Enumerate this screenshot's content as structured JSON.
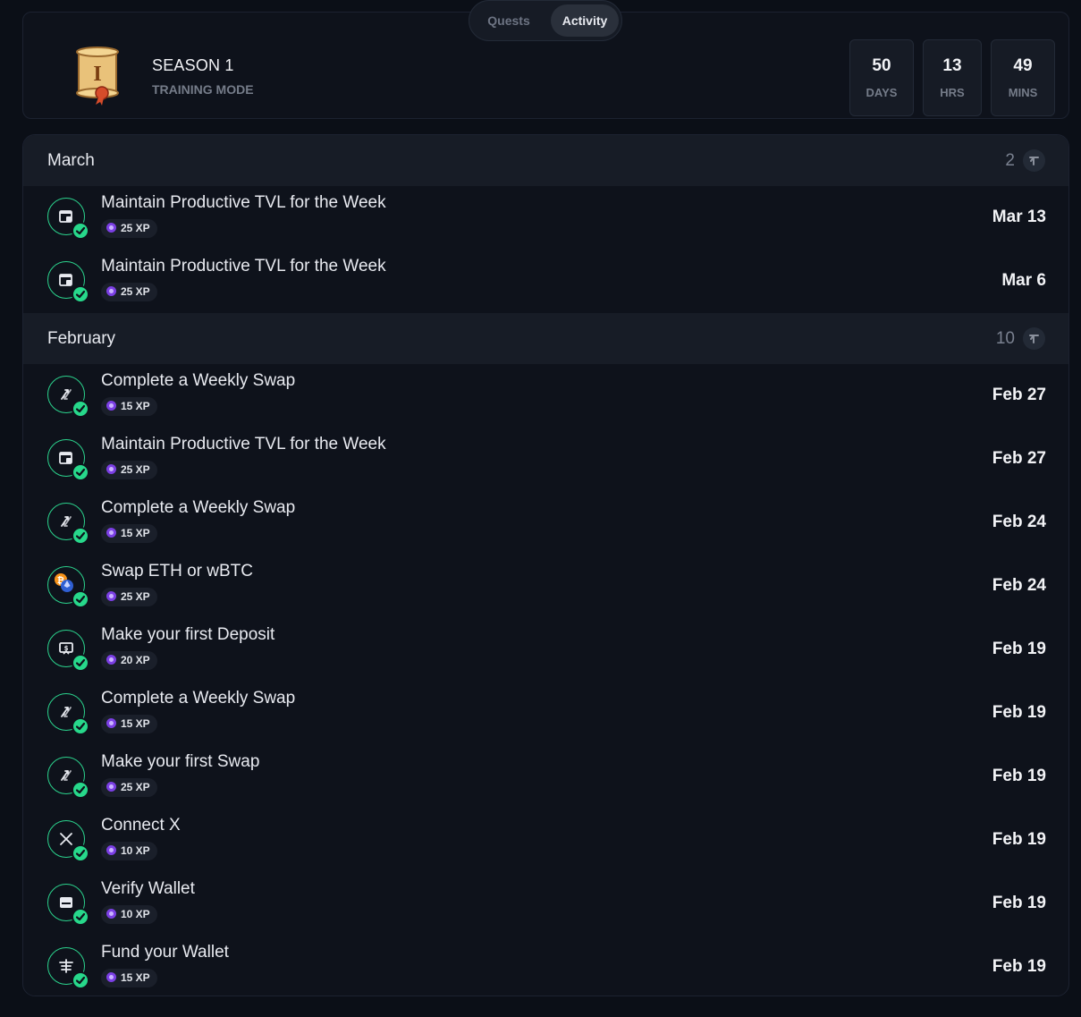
{
  "tabs": {
    "quests": "Quests",
    "activity": "Activity",
    "active": "activity"
  },
  "season": {
    "title": "SEASON 1",
    "subtitle": "TRAINING MODE",
    "badge_letter": "I"
  },
  "timer": [
    {
      "value": "50",
      "unit": "DAYS"
    },
    {
      "value": "13",
      "unit": "HRS"
    },
    {
      "value": "49",
      "unit": "MINS"
    }
  ],
  "months": [
    {
      "name": "March",
      "count": "2",
      "items": [
        {
          "title": "Maintain Productive TVL for the Week",
          "xp": "25 XP",
          "date": "Mar 13",
          "icon": "tvl-icon"
        },
        {
          "title": "Maintain Productive TVL for the Week",
          "xp": "25 XP",
          "date": "Mar 6",
          "icon": "tvl-icon"
        }
      ]
    },
    {
      "name": "February",
      "count": "10",
      "items": [
        {
          "title": "Complete a Weekly Swap",
          "xp": "15 XP",
          "date": "Feb 27",
          "icon": "swap-icon"
        },
        {
          "title": "Maintain Productive TVL for the Week",
          "xp": "25 XP",
          "date": "Feb 27",
          "icon": "tvl-icon"
        },
        {
          "title": "Complete a Weekly Swap",
          "xp": "15 XP",
          "date": "Feb 24",
          "icon": "swap-icon"
        },
        {
          "title": "Swap ETH or wBTC",
          "xp": "25 XP",
          "date": "Feb 24",
          "icon": "btc-eth-icon"
        },
        {
          "title": "Make your first Deposit",
          "xp": "20 XP",
          "date": "Feb 19",
          "icon": "deposit-icon"
        },
        {
          "title": "Complete a Weekly Swap",
          "xp": "15 XP",
          "date": "Feb 19",
          "icon": "swap-icon"
        },
        {
          "title": "Make your first Swap",
          "xp": "25 XP",
          "date": "Feb 19",
          "icon": "swap-icon"
        },
        {
          "title": "Connect X",
          "xp": "10 XP",
          "date": "Feb 19",
          "icon": "x-logo-icon"
        },
        {
          "title": "Verify Wallet",
          "xp": "10 XP",
          "date": "Feb 19",
          "icon": "wallet-icon"
        },
        {
          "title": "Fund your Wallet",
          "xp": "15 XP",
          "date": "Feb 19",
          "icon": "fund-icon"
        }
      ]
    }
  ],
  "colors": {
    "accent": "#27d88b",
    "xp": "#7b3fe4",
    "background": "#0b0f17"
  }
}
